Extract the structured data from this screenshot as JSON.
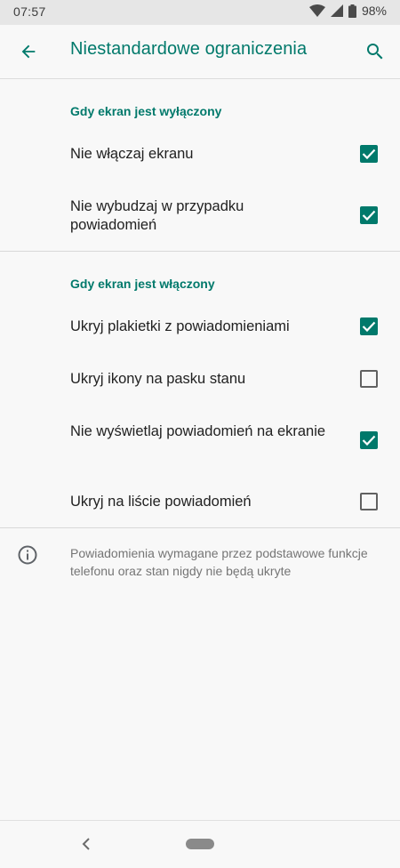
{
  "status_bar": {
    "time": "07:57",
    "battery_percent": "98%",
    "icons": [
      "wifi-icon",
      "signal-icon",
      "battery-icon"
    ]
  },
  "app_bar": {
    "title": "Niestandardowe ograniczenia",
    "back_icon": "arrow-left-icon",
    "search_icon": "search-icon"
  },
  "colors": {
    "accent": "#00796b",
    "background": "#f8f8f8",
    "status_bar": "#e6e6e6"
  },
  "sections": [
    {
      "header": "Gdy ekran jest wyłączony",
      "items": [
        {
          "label": "Nie włączaj ekranu",
          "checked": true
        },
        {
          "label": "Nie wybudzaj w przypadku powiadomień",
          "checked": true
        }
      ]
    },
    {
      "header": "Gdy ekran jest włączony",
      "items": [
        {
          "label": "Ukryj plakietki z powiadomieniami",
          "checked": true
        },
        {
          "label": "Ukryj ikony na pasku stanu",
          "checked": false
        },
        {
          "label": "Nie wyświetlaj powiadomień na ekranie",
          "checked": true
        },
        {
          "label": "Ukryj na liście powiadomień",
          "checked": false
        }
      ]
    }
  ],
  "footer_info": {
    "icon": "info-icon",
    "text": "Powiadomienia wymagane przez podstawowe funkcje telefonu oraz stan nigdy nie będą ukryte"
  },
  "nav_bar": {
    "back_icon": "nav-back-icon",
    "home_icon": "home-pill-icon"
  }
}
